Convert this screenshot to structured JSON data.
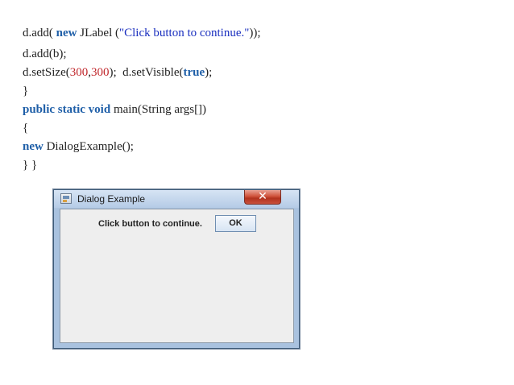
{
  "code_lines": [
    {
      "parts": [
        "d.add( ",
        "new",
        " JLabel (",
        "\"Click button to continue.\"",
        "));"
      ]
    },
    {
      "parts": [
        "d.add(b);"
      ]
    },
    {
      "parts": [
        "d.setSize(",
        "300",
        ",",
        "300",
        ");  d.setVisible(",
        "true",
        ");"
      ]
    },
    {
      "parts": [
        "}"
      ]
    },
    {
      "parts": [
        "public static void",
        " main(String args[])"
      ]
    },
    {
      "parts": [
        "{"
      ]
    },
    {
      "parts": [
        "new",
        " DialogExample();"
      ]
    },
    {
      "parts": [
        "} }"
      ]
    }
  ],
  "dialog": {
    "title": "Dialog Example",
    "close_glyph": "✕",
    "label": "Click button to continue.",
    "ok_label": "OK",
    "icon": "java-app-icon"
  }
}
